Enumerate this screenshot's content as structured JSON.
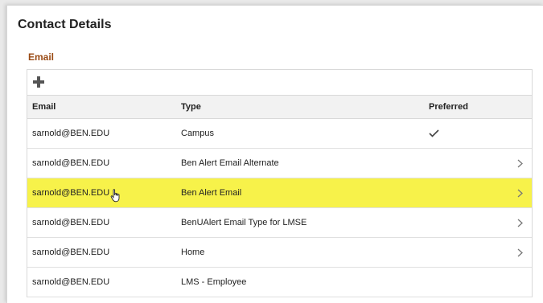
{
  "page": {
    "title": "Contact Details"
  },
  "email_section": {
    "title": "Email",
    "add_icon": "plus-icon",
    "columns": {
      "email": "Email",
      "type": "Type",
      "preferred": "Preferred"
    },
    "rows": [
      {
        "email": "sarnold@BEN.EDU",
        "type": "Campus",
        "preferred": true,
        "has_detail": false
      },
      {
        "email": "sarnold@BEN.EDU",
        "type": "Ben Alert Email Alternate",
        "preferred": false,
        "has_detail": true
      },
      {
        "email": "sarnold@BEN.EDU",
        "type": "Ben Alert Email",
        "preferred": false,
        "has_detail": true,
        "selected": true
      },
      {
        "email": "sarnold@BEN.EDU",
        "type": "BenUAlert Email Type for LMSE",
        "preferred": false,
        "has_detail": true
      },
      {
        "email": "sarnold@BEN.EDU",
        "type": "Home",
        "preferred": false,
        "has_detail": true
      },
      {
        "email": "sarnold@BEN.EDU",
        "type": "LMS - Employee",
        "preferred": false,
        "has_detail": false
      }
    ]
  },
  "colors": {
    "section_title": "#9a4a14",
    "selected_row": "#f7f24a",
    "header_bg": "#f2f2f2"
  },
  "icons": {
    "preferred": "checkmark-icon",
    "detail": "chevron-right-icon",
    "pointer": "hand-pointer-icon"
  }
}
